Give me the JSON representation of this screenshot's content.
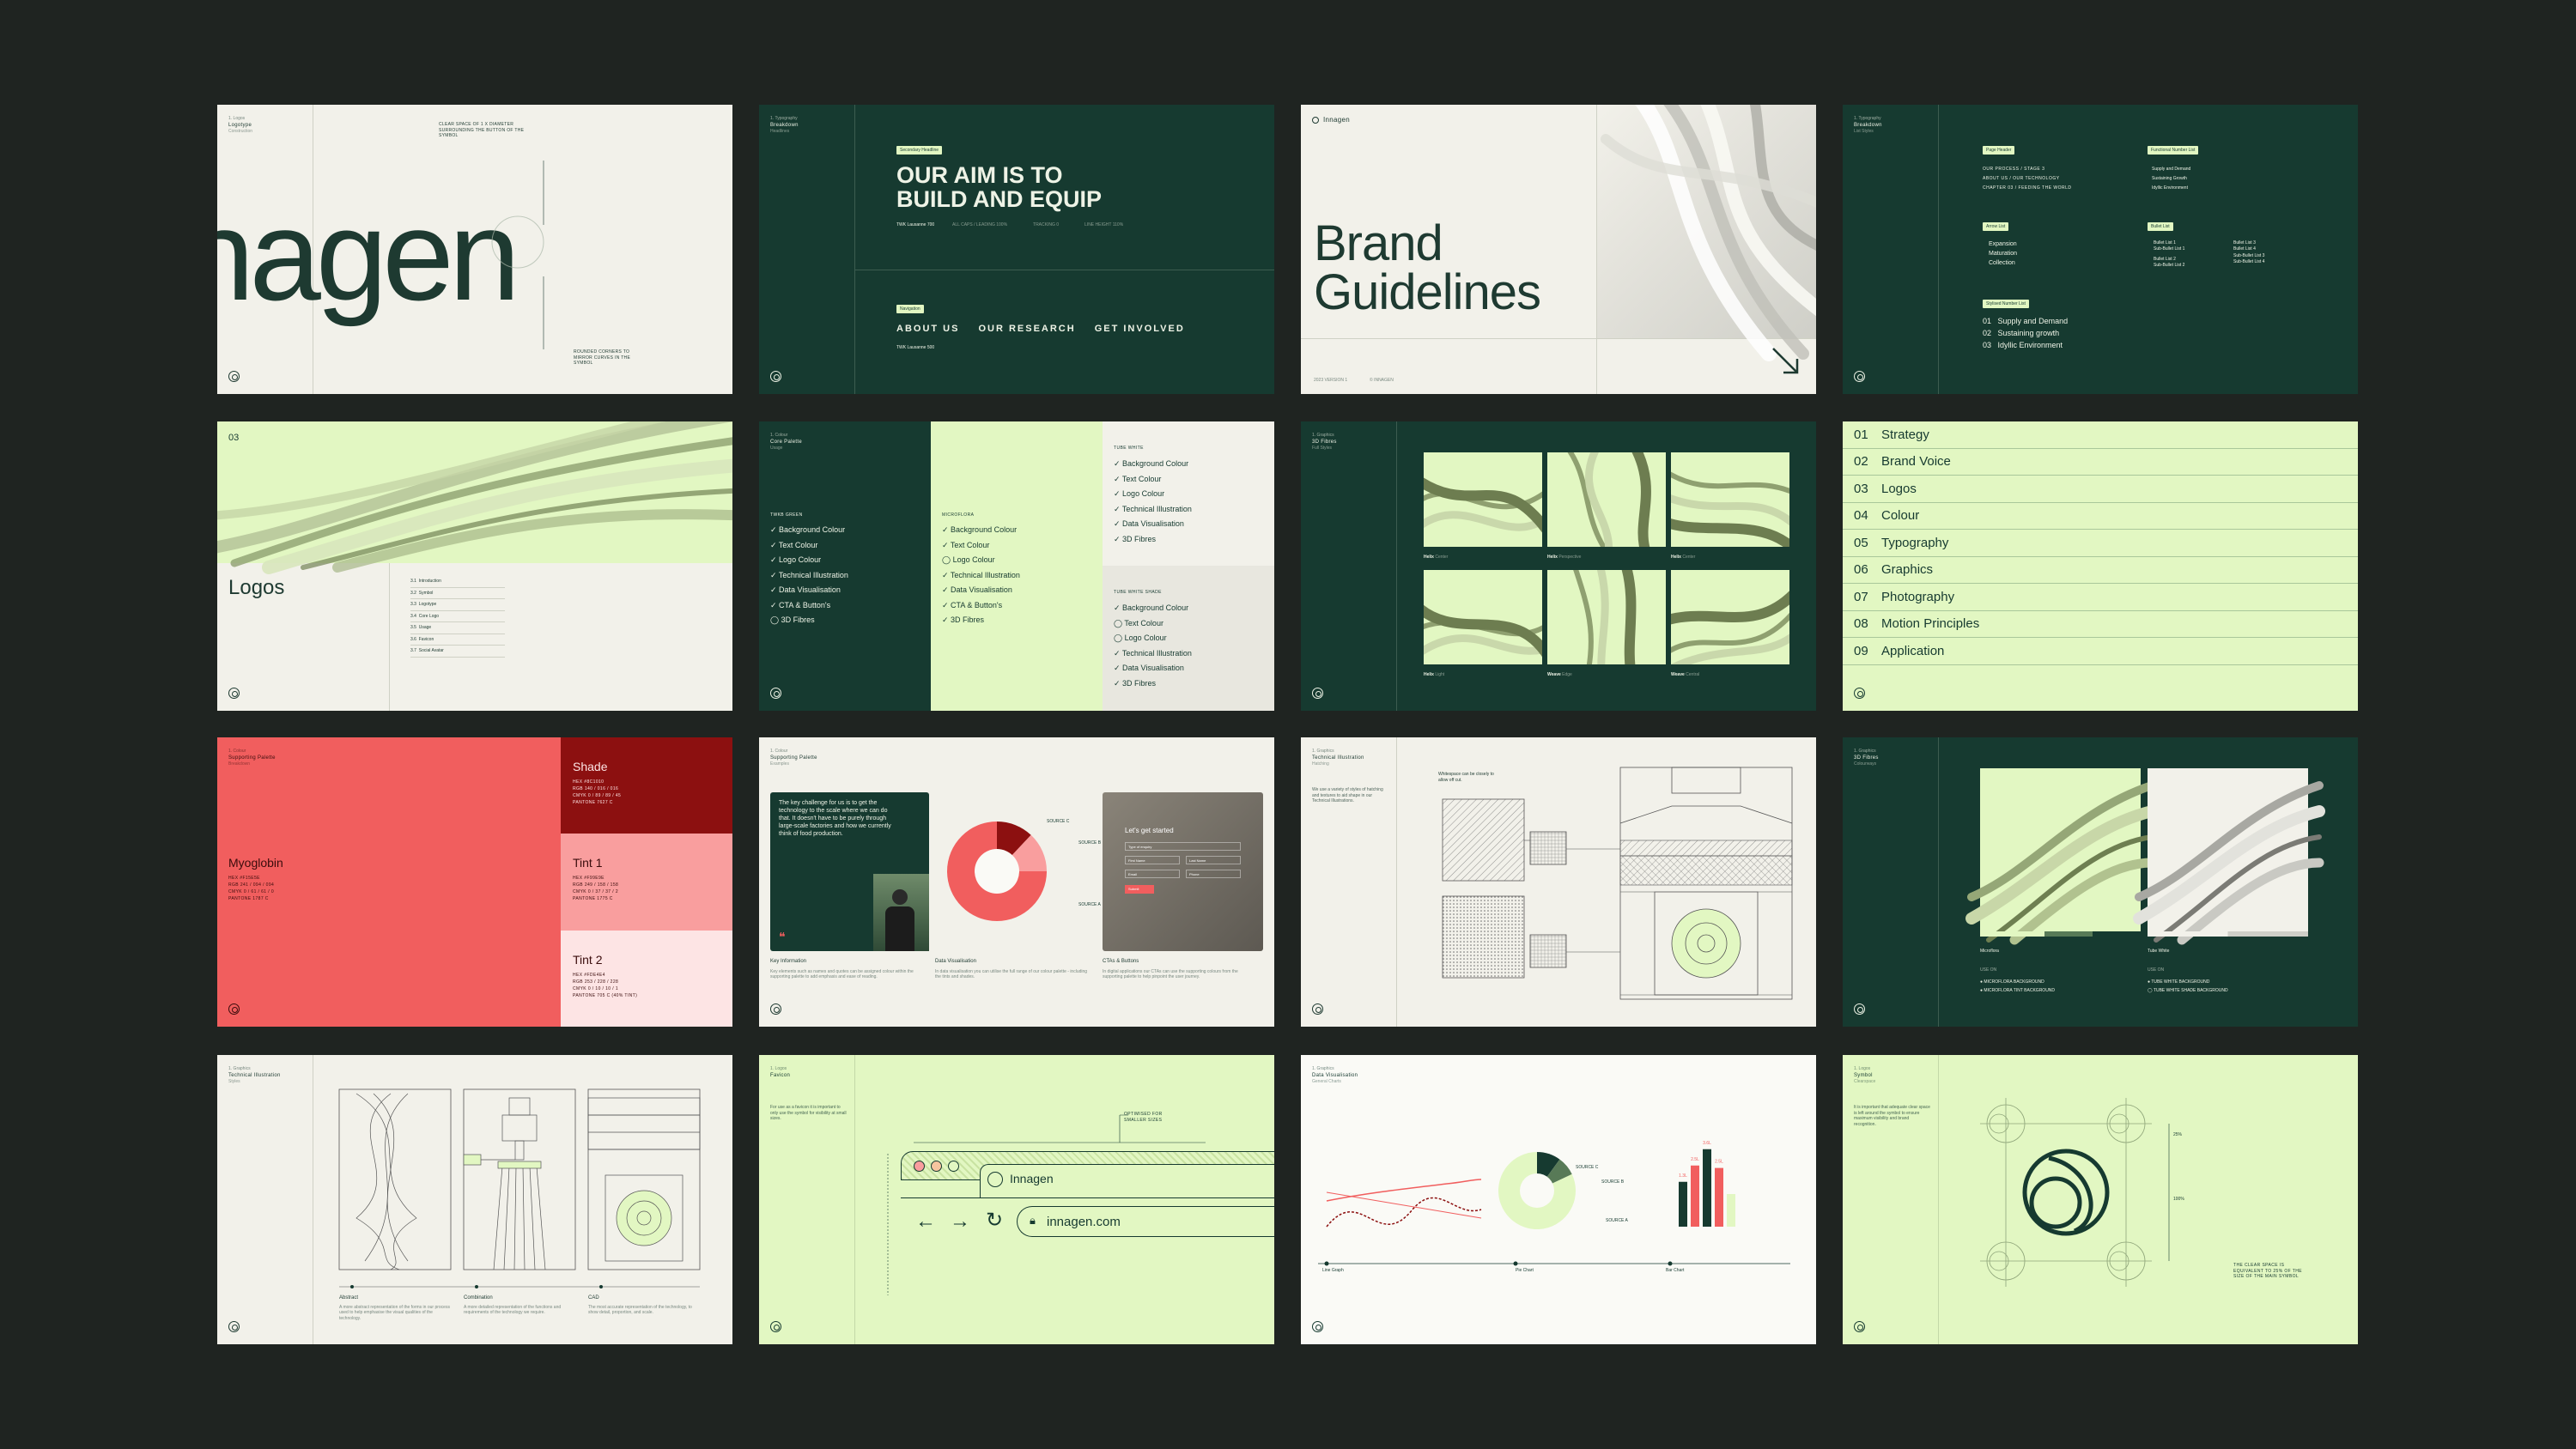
{
  "slides": {
    "logotype": {
      "eyebrow": "1. Logos",
      "title": "Logotype",
      "subtitle": "Construction",
      "wordmark": "nagen",
      "annotation_top": "CLEAR SPACE OF 1 X DIAMETER SURROUNDING THE BUTTON OF THE SYMBOL",
      "annotation_bottom": "ROUNDED CORNERS TO MIRROR CURVES IN THE SYMBOL"
    },
    "breakdown": {
      "eyebrow": "1. Typography",
      "title": "Breakdown",
      "subtitle": "Headlines",
      "tag_secondary": "Secondary Headline",
      "headline_line1": "OUR AIM IS TO",
      "headline_line2": "BUILD AND EQUIP",
      "spec1": "TWK Lausanne 700",
      "spec_items": [
        "ALL CAPS / LEADING 100%",
        "TRACKING 0",
        "LINE HEIGHT 110%"
      ],
      "tag_nav": "Navigation",
      "nav_items": [
        "ABOUT US",
        "OUR RESEARCH",
        "GET INVOLVED"
      ],
      "spec2": "TWK Lausanne 500"
    },
    "cover": {
      "brand": "Innagen",
      "title_line1": "Brand",
      "title_line2": "Guidelines",
      "footer_left": "2023 VERSION 1",
      "footer_mid": "© INNAGEN"
    },
    "lists": {
      "eyebrow": "1. Typography",
      "title": "Breakdown",
      "subtitle": "List Styles",
      "tags": [
        "Page Header",
        "Functional Number List",
        "Arrow List",
        "Bullet List",
        "Stylised Number List"
      ],
      "page_header_items": [
        "OUR PROCESS / STAGE 3",
        "ABOUT US / OUR TECHNOLOGY",
        "CHAPTER 03 / FEEDING THE WORLD"
      ],
      "functional_items": [
        "Supply and Demand",
        "Sustaining Growth",
        "Idyllic Environment"
      ],
      "arrow_items": [
        "Expansion",
        "Maturation",
        "Collection"
      ],
      "bullet_items": [
        "Bullet List 1",
        "Sub-Bullet List 1",
        "Bullet List 2",
        "Sub-Bullet List 2",
        "Bullet List 3",
        "Bullet List 4",
        "Sub-Bullet List 3",
        "Sub-Bullet List 4"
      ],
      "stylised_items": [
        {
          "n": "01",
          "t": "Supply and Demand"
        },
        {
          "n": "02",
          "t": "Sustaining growth"
        },
        {
          "n": "03",
          "t": "Idyllic Environment"
        }
      ]
    },
    "logos": {
      "number": "03",
      "title": "Logos",
      "items": [
        {
          "n": "3.1",
          "t": "Introduction"
        },
        {
          "n": "3.2",
          "t": "Symbol"
        },
        {
          "n": "3.3",
          "t": "Logotype"
        },
        {
          "n": "3.4",
          "t": "Core Logo"
        },
        {
          "n": "3.5",
          "t": "Usage"
        },
        {
          "n": "3.6",
          "t": "Favicon"
        },
        {
          "n": "3.7",
          "t": "Social Avatar"
        }
      ]
    },
    "palette": {
      "eyebrow": "1. Colour",
      "title": "Core Palette",
      "subtitle": "Usage",
      "col1_label": "TWKB GREEN",
      "col1_items": [
        "Background Colour",
        "Text Colour",
        "Logo Colour",
        "Technical Illustration",
        "Data Visualisation",
        "CTA & Button's",
        "3D Fibres"
      ],
      "col2_label": "MICROFLORA",
      "col2_items": [
        "Background Colour",
        "Text Colour",
        "Logo Colour",
        "Technical Illustration",
        "Data Visualisation",
        "CTA & Button's",
        "3D Fibres"
      ],
      "col3_label": "TUBE WHITE",
      "col3_items": [
        "Background Colour",
        "Text Colour",
        "Logo Colour",
        "Technical Illustration",
        "Data Visualisation",
        "3D Fibres"
      ],
      "col4_label": "TUBE WHITE SHADE",
      "col4_items": [
        "Background Colour",
        "Text Colour",
        "Logo Colour",
        "Technical Illustration",
        "Data Visualisation",
        "3D Fibres"
      ]
    },
    "fibres": {
      "eyebrow": "1. Graphics",
      "title": "3D Fibres",
      "subtitle": "Full Styles",
      "captions": [
        {
          "b": "Helix",
          "s": "Center"
        },
        {
          "b": "Helix",
          "s": "Perspective"
        },
        {
          "b": "Helix",
          "s": "Center"
        },
        {
          "b": "Helix",
          "s": "Light"
        },
        {
          "b": "Weave",
          "s": "Edge"
        },
        {
          "b": "Weave",
          "s": "Central"
        }
      ]
    },
    "contents": {
      "items": [
        {
          "n": "01",
          "t": "Strategy"
        },
        {
          "n": "02",
          "t": "Brand Voice"
        },
        {
          "n": "03",
          "t": "Logos"
        },
        {
          "n": "04",
          "t": "Colour"
        },
        {
          "n": "05",
          "t": "Typography"
        },
        {
          "n": "06",
          "t": "Graphics"
        },
        {
          "n": "07",
          "t": "Photography"
        },
        {
          "n": "08",
          "t": "Motion Principles"
        },
        {
          "n": "09",
          "t": "Application"
        }
      ]
    },
    "supporting": {
      "eyebrow": "1. Colour",
      "title": "Supporting Palette",
      "subtitle": "Breakdown",
      "main": "Myoglobin",
      "main_spec": [
        "HEX #F15E5E",
        "RGB 241 / 094 / 094",
        "CMYK 0 / 61 / 61 / 0",
        "PANTONE 1787 C"
      ],
      "shade": "Shade",
      "shade_spec": [
        "HEX #8C1010",
        "RGB 140 / 016 / 016",
        "CMYK 0 / 89 / 89 / 45",
        "PANTONE 7627 C"
      ],
      "tint1": "Tint 1",
      "tint1_spec": [
        "HEX #F99E9E",
        "RGB 249 / 158 / 158",
        "CMYK 0 / 37 / 37 / 2",
        "PANTONE 1775 C"
      ],
      "tint2": "Tint 2",
      "tint2_spec": [
        "HEX #FDE4E4",
        "RGB 253 / 228 / 228",
        "CMYK 0 / 10 / 10 / 1",
        "PANTONE 705 C (40% TINT)"
      ]
    },
    "supporting_examples": {
      "eyebrow": "1. Colour",
      "title": "Supporting Palette",
      "subtitle": "Examples",
      "quote": "The key challenge for us is to get the technology to the scale where we can do that. It doesn't have to be purely through large-scale factories and how we currently think of food production.",
      "source_labels": [
        "SOURCE C",
        "SOURCE B",
        "SOURCE A"
      ],
      "form_title": "Let's get started",
      "form_fields": [
        "Type of enquiry",
        "First Name",
        "Last Name",
        "Email",
        "Phone"
      ],
      "form_button": "Submit",
      "captions": [
        {
          "t": "Key Information",
          "d": "Key elements such as names and quotes can be assigned colour within the supporting palette to add emphasis and ease of reading."
        },
        {
          "t": "Data Visualisation",
          "d": "In data visualisation you can utilise the full range of our colour palette - including the tints and shades."
        },
        {
          "t": "CTAs & Buttons",
          "d": "In digital applications our CTAs can use the supporting colours from the supporting palette to help pinpoint the user journey."
        }
      ]
    },
    "tech": {
      "eyebrow": "1. Graphics",
      "title": "Technical Illustration",
      "subtitle": "Hatching",
      "body": "We use a variety of styles of hatching and textures to aid shape in our Technical Illustrations.",
      "annotation": "Whitespace can be closely to allow off cut."
    },
    "fibres2": {
      "eyebrow": "1. Graphics",
      "title": "3D Fibres",
      "subtitle": "Colourways",
      "label1": "Microflora",
      "label2": "Tube White",
      "use_on": "USE ON",
      "opts1": [
        "MICROFLORA BACKGROUND",
        "MICROFLORA TINT BACKGROUND"
      ],
      "opts2": [
        "TUBE WHITE BACKGROUND",
        "TUBE WHITE SHADE BACKGROUND"
      ]
    },
    "tech2": {
      "eyebrow": "1. Graphics",
      "title": "Technical Illustration",
      "subtitle": "Styles",
      "labels": [
        {
          "t": "Abstract",
          "d": "A more abstract representation of the forms in our process used to help emphasise the visual qualities of the technology."
        },
        {
          "t": "Combination",
          "d": "A more detailed representation of the functions and requirements of the technology we require."
        },
        {
          "t": "CAD",
          "d": "The most accurate representation of the technology, to show detail, proportion, and scale."
        }
      ]
    },
    "favicon": {
      "eyebrow": "1. Logos",
      "title": "Favicon",
      "body": "For use as a favicon it is important to only use the symbol for visibility at small sizes.",
      "annotation": "OPTIMISED FOR SMALLER SIZES",
      "tab_name": "Innagen",
      "url": "innagen.com"
    },
    "dataviz": {
      "eyebrow": "1. Graphics",
      "title": "Data Visualisation",
      "subtitle": "General Charts",
      "source_labels": [
        "SOURCE C",
        "SOURCE B",
        "SOURCE A"
      ],
      "chart_labels": [
        "Line Graph",
        "Pie Chart",
        "Bar Chart"
      ],
      "bar_values": [
        "1.3L",
        "2.5L",
        "3.6L",
        "2.5L"
      ]
    },
    "symbol": {
      "eyebrow": "1. Logos",
      "title": "Symbol",
      "subtitle": "Clearspace",
      "body": "It is important that adequate clear space is left around the symbol to ensure maximum visibility and brand recognition.",
      "annotation": "THE CLEAR SPACE IS EQUIVALENT TO 25% OF THE SIZE OF THE MAIN SYMBOL",
      "marks": [
        "25%",
        "100%"
      ]
    }
  },
  "colors": {
    "background": "#1f2421",
    "green": "#163a30",
    "lime": "#e2f7c2",
    "cream": "#f2f1ea",
    "red": "#f15e5e",
    "shade": "#8c1010",
    "tint1": "#f99e9e",
    "tint2": "#fde4e4"
  }
}
